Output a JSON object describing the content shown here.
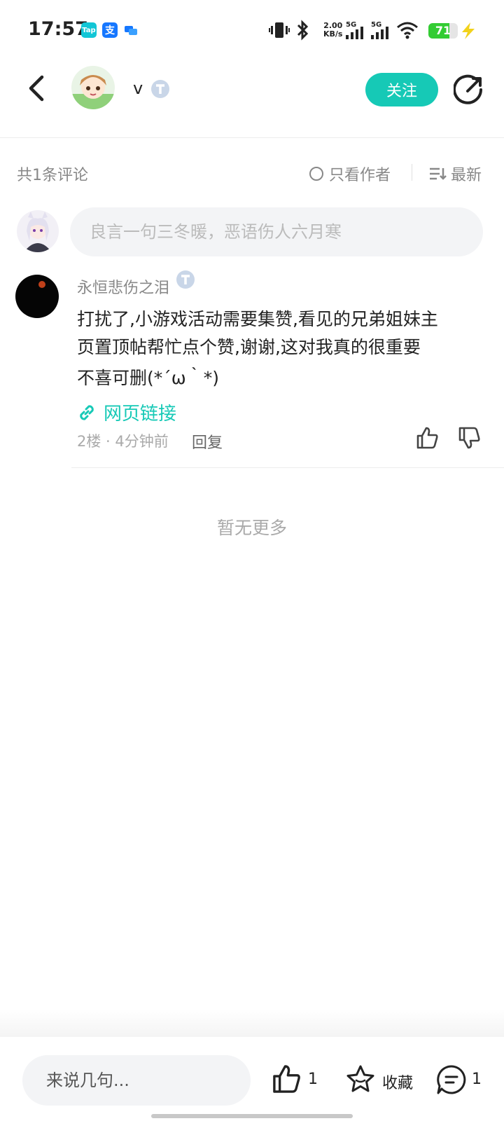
{
  "status_bar": {
    "time": "17:57",
    "app_icons": [
      "taptap-icon",
      "alipay-icon",
      "chat-icon"
    ],
    "net_speed_value": "2.00",
    "net_speed_unit": "KB/s",
    "signal_1_label": "5G",
    "signal_2_label": "5G",
    "battery_level": "71",
    "battery_fraction": 0.71
  },
  "header": {
    "author_name": "v",
    "follow_label": "关注"
  },
  "comments_bar": {
    "count_text": "共1条评论",
    "author_only_label": "只看作者",
    "sort_label": "最新"
  },
  "reply_input": {
    "placeholder": "良言一句三冬暖，恶语伤人六月寒"
  },
  "comment": {
    "user_name": "永恒悲伤之泪",
    "text_line_1": "打扰了,小游戏活动需要集赞,看见的兄弟姐妹主",
    "text_line_2": "页置顶帖帮忙点个赞,谢谢,这对我真的很重要",
    "text_line_3": "不喜可删(*´ω｀*)",
    "link_label": "网页链接",
    "meta": "2楼 · 4分钟前",
    "reply_label": "回复"
  },
  "footer": {
    "no_more": "暂无更多"
  },
  "bottom_bar": {
    "input_placeholder": "来说几句...",
    "like_count": "1",
    "favorite_label": "收藏",
    "comment_count": "1"
  },
  "colors": {
    "accent": "#16c9b6",
    "text_primary": "#222222",
    "text_secondary": "#888888",
    "battery_green": "#33cc33"
  }
}
